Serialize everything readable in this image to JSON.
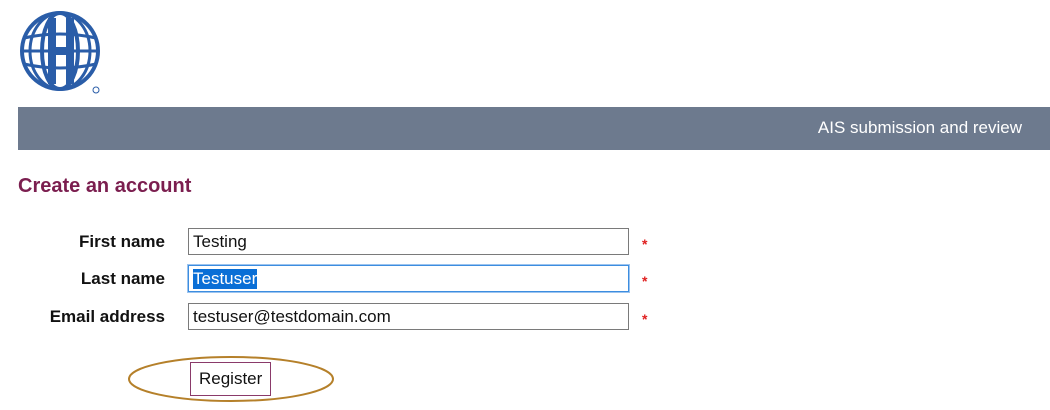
{
  "header": {
    "logo_name": "globe-logo",
    "banner_title": "AIS submission and review"
  },
  "page": {
    "title": "Create an account"
  },
  "form": {
    "fields": [
      {
        "label": "First name",
        "value": "Testing",
        "required_mark": "*",
        "focused": false
      },
      {
        "label": "Last name",
        "value": "Testuser",
        "required_mark": "*",
        "focused": true
      },
      {
        "label": "Email address",
        "value": "testuser@testdomain.com",
        "required_mark": "*",
        "focused": false
      }
    ],
    "register_label": "Register"
  },
  "colors": {
    "banner": "#6d7a8e",
    "title": "#7b1e4f",
    "required": "#e02020",
    "annotation": "#b5802a",
    "logo": "#2a5da8"
  }
}
